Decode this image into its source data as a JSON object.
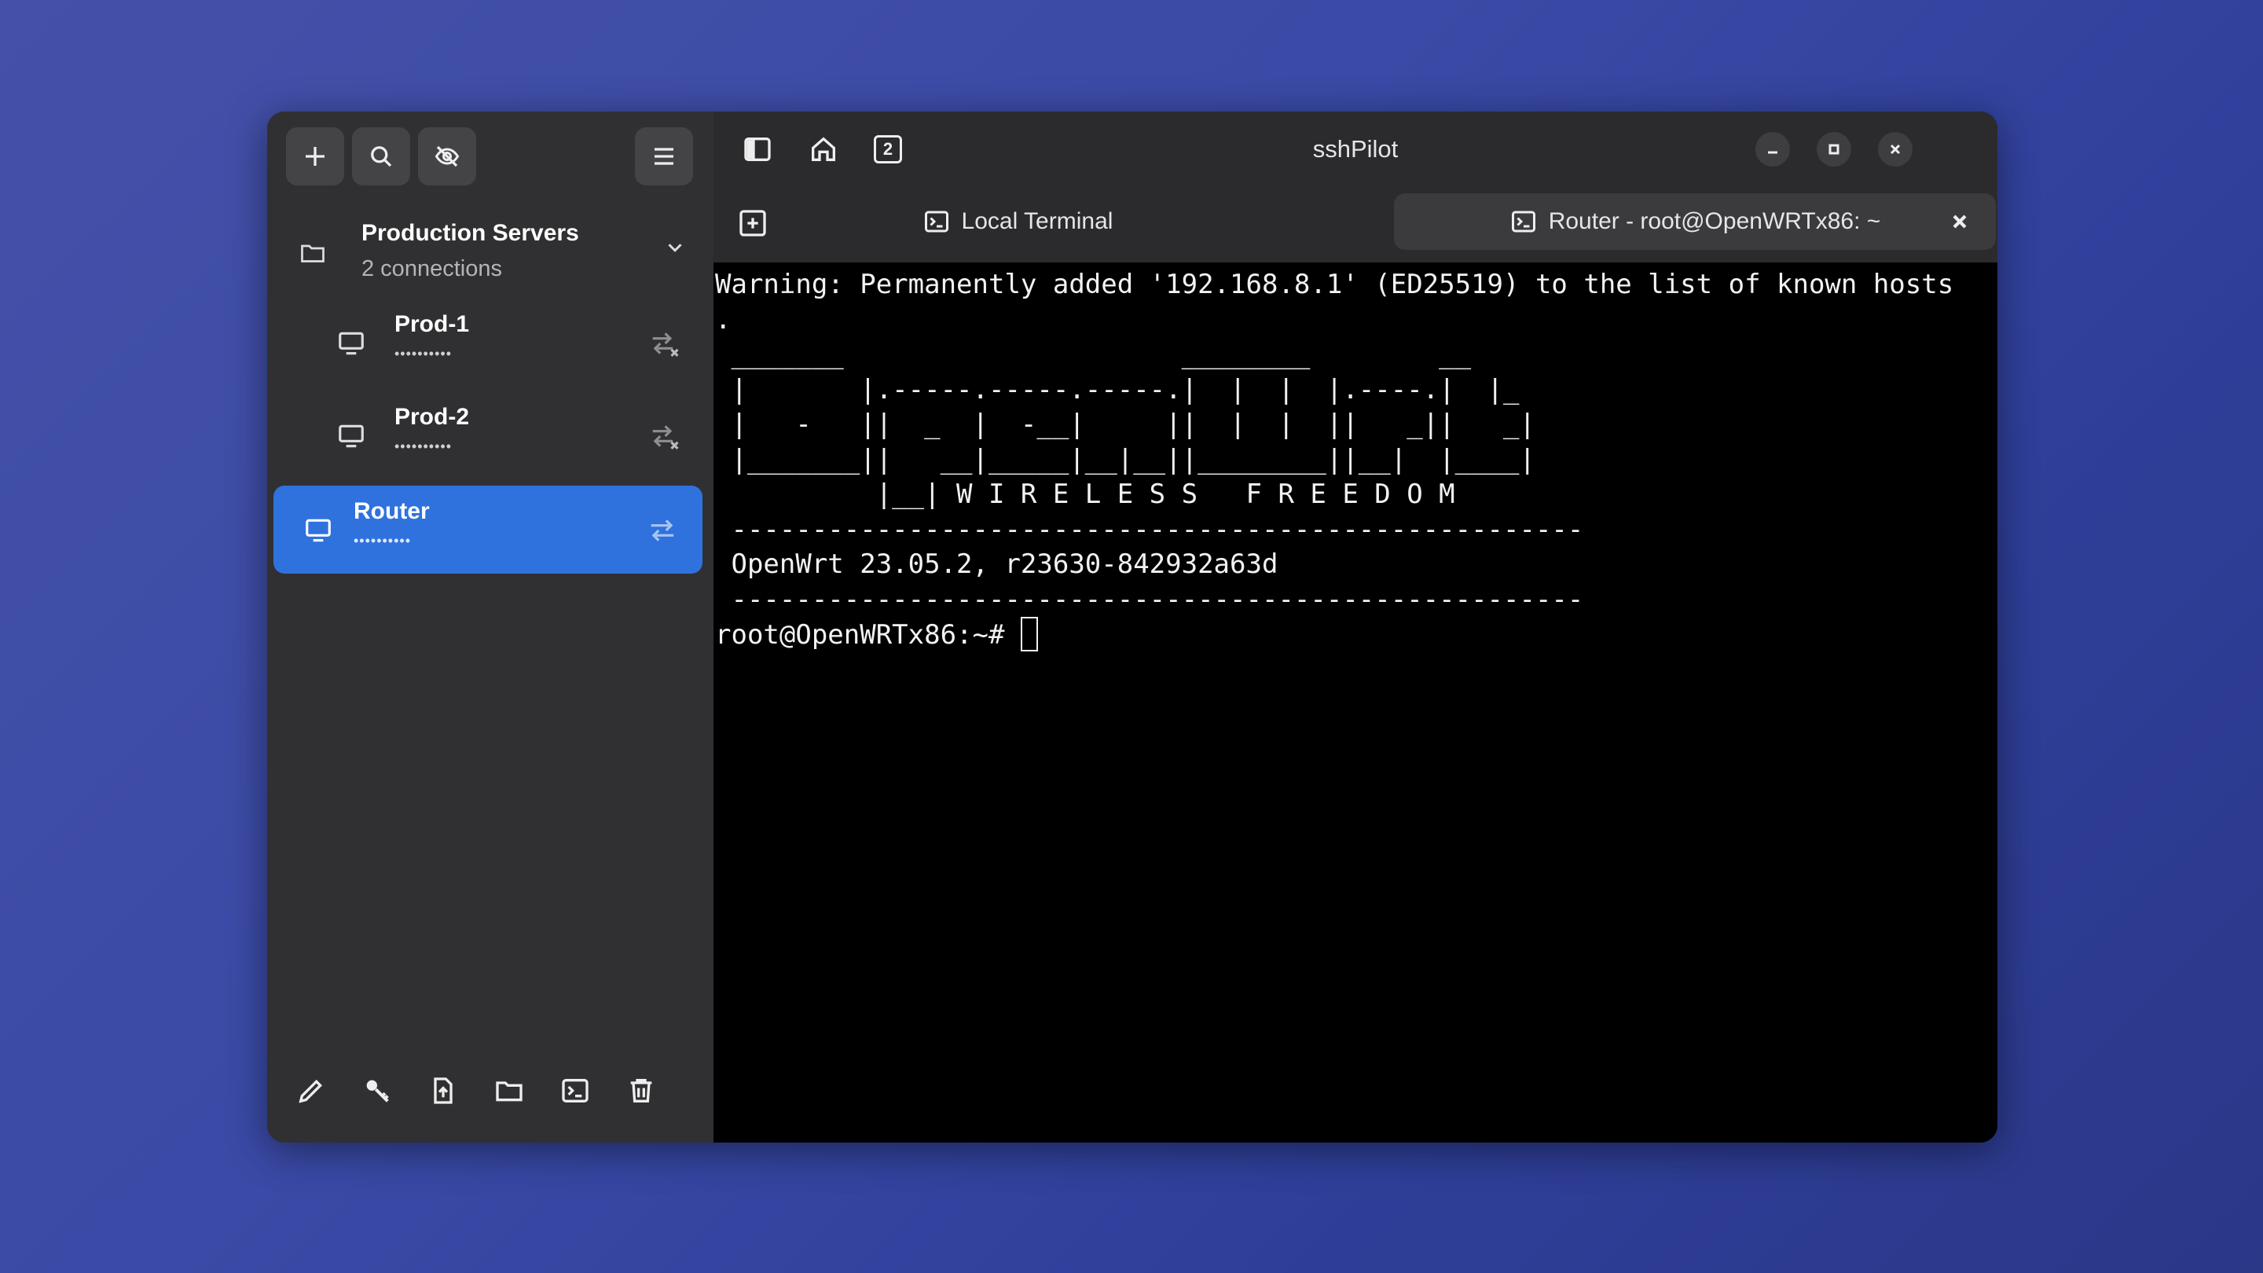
{
  "app": {
    "title": "sshPilot"
  },
  "sidebar": {
    "group": {
      "title": "Production Servers",
      "subtitle": "2 connections"
    },
    "connections": [
      {
        "name": "Prod-1",
        "host_masked": "••••••••••"
      },
      {
        "name": "Prod-2",
        "host_masked": "••••••••••"
      },
      {
        "name": "Router",
        "host_masked": "••••••••••"
      }
    ]
  },
  "tabs": [
    {
      "label": "Local Terminal"
    },
    {
      "label": "Router - root@OpenWRTx86: ~"
    }
  ],
  "header": {
    "tab_count": "2"
  },
  "terminal": {
    "lines": [
      "Warning: Permanently added '192.168.8.1' (ED25519) to the list of known hosts",
      ".",
      " _______                     ________        __",
      " |       |.-----.-----.-----.|  |  |  |.----.|  |_",
      " |   -   ||  _  |  -__|     ||  |  |  ||   _||   _|",
      " |_______||   __|_____|__|__||________||__|  |____|",
      "          |__| W I R E L E S S   F R E E D O M",
      " -----------------------------------------------------",
      " OpenWrt 23.05.2, r23630-842932a63d",
      " -----------------------------------------------------"
    ],
    "prompt": "root@OpenWRTx86:~# "
  },
  "colors": {
    "accent": "#2f72de",
    "sidebar": "#303032",
    "header": "#2b2b2d",
    "terminal_bg": "#000000"
  }
}
